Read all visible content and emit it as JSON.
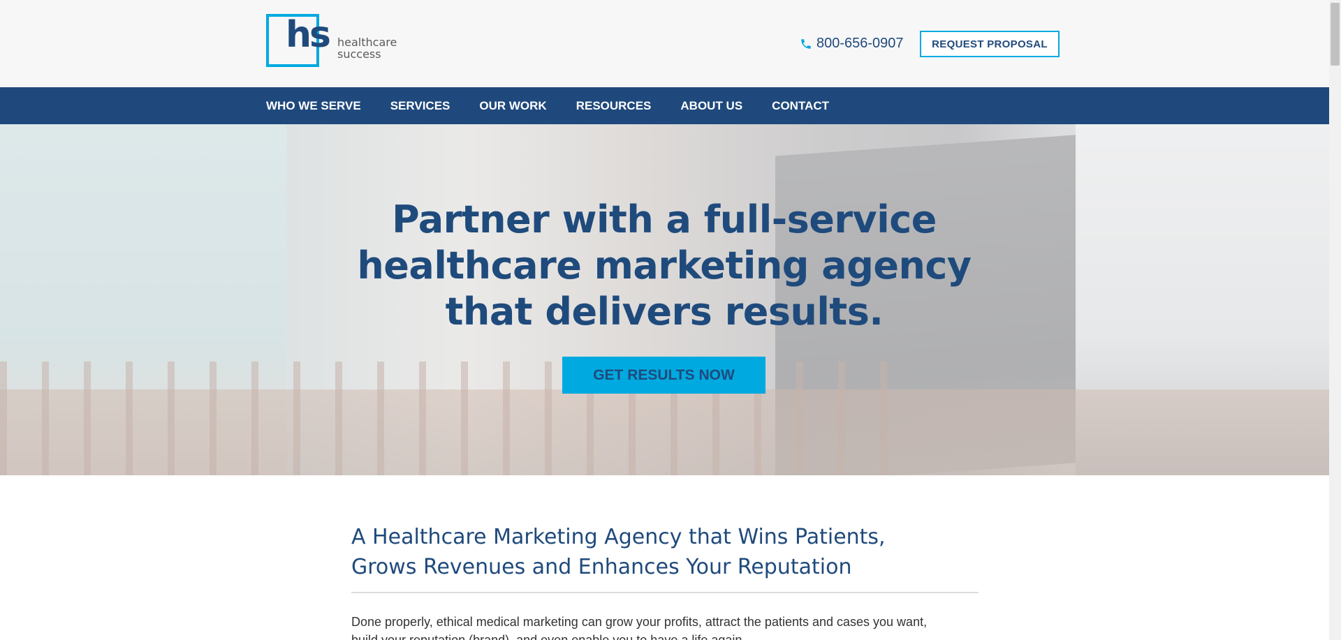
{
  "header": {
    "logo_mark": "hs",
    "logo_word_1": "healthcare",
    "logo_word_2": "success",
    "phone": "800-656-0907",
    "request_label": "REQUEST PROPOSAL"
  },
  "nav": {
    "items": [
      "WHO WE SERVE",
      "SERVICES",
      "OUR WORK",
      "RESOURCES",
      "ABOUT US",
      "CONTACT"
    ]
  },
  "hero": {
    "title_line_1": "Partner with a full-service",
    "title_line_2": "healthcare marketing agency",
    "title_line_3": "that delivers results.",
    "cta_label": "GET RESULTS NOW"
  },
  "content": {
    "heading_line_1": "A Healthcare Marketing Agency that Wins Patients,",
    "heading_line_2": "Grows Revenues and Enhances Your Reputation",
    "paragraph_line_1": "Done properly, ethical medical marketing can grow your profits, attract the patients and cases you want,",
    "paragraph_line_2": "build your reputation (brand), and even enable you to have a life again."
  },
  "colors": {
    "brand_navy": "#1f497d",
    "accent_cyan": "#00a9e0"
  },
  "icons": {
    "phone": "phone-icon"
  }
}
